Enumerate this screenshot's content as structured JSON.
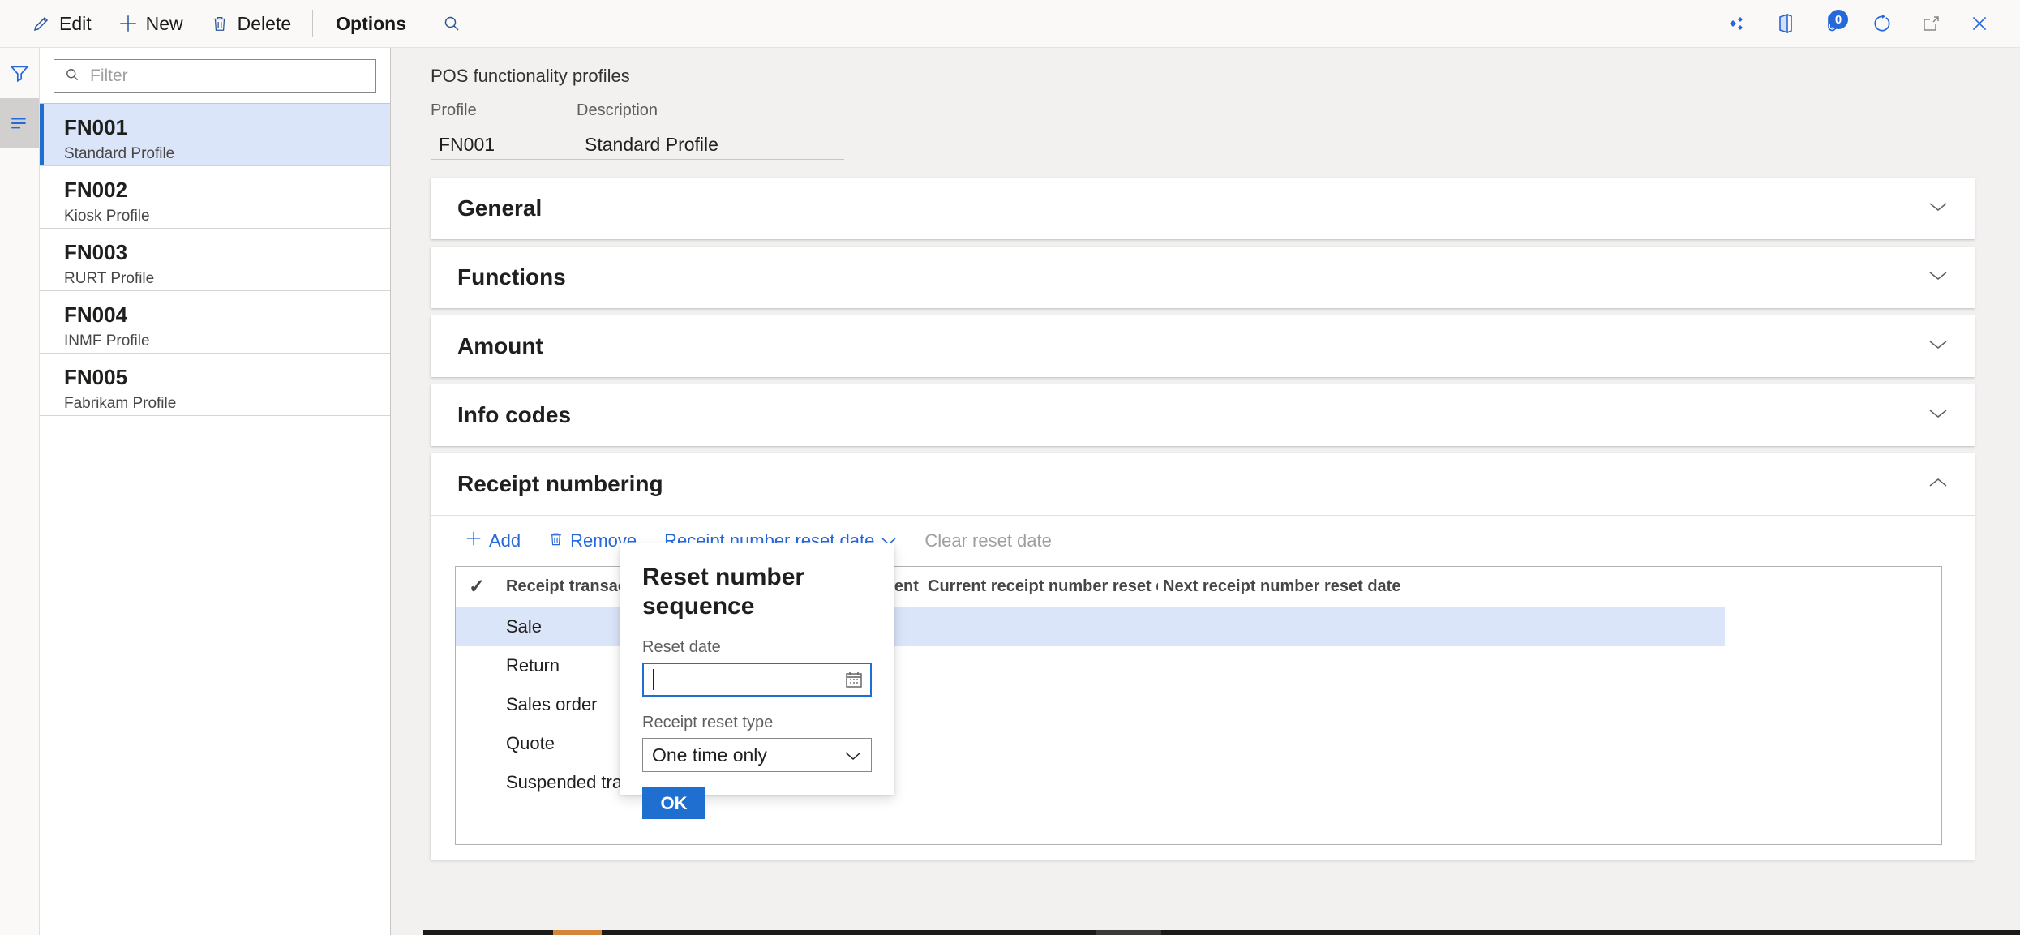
{
  "commandbar": {
    "buttons": [
      {
        "label": "Edit",
        "icon": "pencil-icon"
      },
      {
        "label": "New",
        "icon": "plus-icon"
      },
      {
        "label": "Delete",
        "icon": "trash-icon"
      }
    ],
    "options_label": "Options",
    "search_icon": "search-icon",
    "right_icons": [
      {
        "name": "dynamics-diamond-icon"
      },
      {
        "name": "office-app-icon"
      },
      {
        "name": "attachment-icon",
        "badge": "0"
      },
      {
        "name": "refresh-icon"
      },
      {
        "name": "open-in-new-window-icon"
      },
      {
        "name": "close-icon"
      }
    ]
  },
  "rail": {
    "filter_icon": "funnel-filter-icon",
    "list_icon": "list-lines-icon"
  },
  "listpane": {
    "filter_placeholder": "Filter",
    "filter_value": "",
    "items": [
      {
        "id": "FN001",
        "desc": "Standard Profile",
        "selected": true
      },
      {
        "id": "FN002",
        "desc": "Kiosk Profile",
        "selected": false
      },
      {
        "id": "FN003",
        "desc": "RURT Profile",
        "selected": false
      },
      {
        "id": "FN004",
        "desc": "INMF Profile",
        "selected": false
      },
      {
        "id": "FN005",
        "desc": "Fabrikam Profile",
        "selected": false
      }
    ]
  },
  "page": {
    "title": "POS functionality profiles",
    "fields": [
      {
        "label": "Profile",
        "value": "FN001"
      },
      {
        "label": "Description",
        "value": "Standard Profile"
      }
    ]
  },
  "sections": [
    {
      "title": "General",
      "expanded": false,
      "chevron": "chevron-down-icon"
    },
    {
      "title": "Functions",
      "expanded": false,
      "chevron": "chevron-down-icon"
    },
    {
      "title": "Amount",
      "expanded": false,
      "chevron": "chevron-down-icon"
    },
    {
      "title": "Info codes",
      "expanded": false,
      "chevron": "chevron-down-icon"
    },
    {
      "title": "Receipt numbering",
      "expanded": true,
      "chevron": "chevron-up-icon"
    }
  ],
  "gridbar": {
    "add_label": "Add",
    "remove_label": "Remove",
    "reset_date_label": "Receipt number reset date",
    "clear_label": "Clear reset date"
  },
  "grid": {
    "columns": [
      "Receipt transaction t...",
      "Independent se...",
      "Current receipt number reset date",
      "Next receipt number reset date"
    ],
    "rows": [
      {
        "type": "Sale",
        "independent": true,
        "current": "",
        "next": "",
        "selected": true
      },
      {
        "type": "Return",
        "independent": true,
        "current": "",
        "next": "",
        "selected": false
      },
      {
        "type": "Sales order",
        "independent": true,
        "current": "",
        "next": "",
        "selected": false
      },
      {
        "type": "Quote",
        "independent": true,
        "current": "",
        "next": "",
        "selected": false
      },
      {
        "type": "Suspended transaction",
        "independent": true,
        "current": "",
        "next": "",
        "selected": false
      }
    ]
  },
  "dialog": {
    "title": "Reset number sequence",
    "reset_date_label": "Reset date",
    "reset_date_value": "",
    "calendar_icon": "calendar-icon",
    "reset_type_label": "Receipt reset type",
    "reset_type_value": "One time only",
    "reset_type_options": [
      "One time only"
    ],
    "ok_label": "OK"
  },
  "colors": {
    "accent": "#1f6fd0",
    "link": "#2667d9",
    "selection": "#dbe5f9",
    "badge": "#2667d9"
  }
}
